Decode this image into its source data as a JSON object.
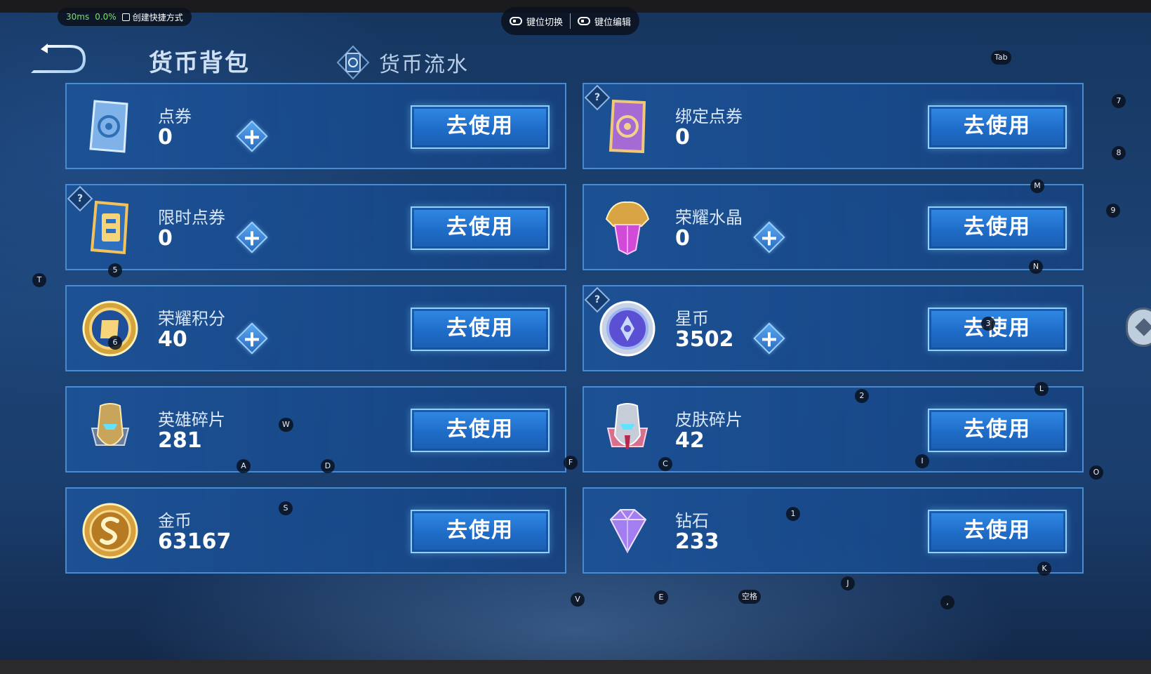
{
  "overlay": {
    "latency": "30ms",
    "loss": "0.0%",
    "shortcut_label": "创建快捷方式",
    "key_switch_label": "键位切换",
    "key_edit_label": "键位编辑"
  },
  "header": {
    "title": "货币背包",
    "flow_tab": "货币流水"
  },
  "use_label": "去使用",
  "help_mark": "?",
  "cards": [
    {
      "name": "点券",
      "value": "0",
      "icon": "coupon-icon",
      "plus": true,
      "help": false
    },
    {
      "name": "绑定点券",
      "value": "0",
      "icon": "bound-coupon-icon",
      "plus": false,
      "help": true
    },
    {
      "name": "限时点券",
      "value": "0",
      "icon": "limited-coupon-icon",
      "plus": true,
      "help": true
    },
    {
      "name": "荣耀水晶",
      "value": "0",
      "icon": "glory-crystal-icon",
      "plus": true,
      "help": false
    },
    {
      "name": "荣耀积分",
      "value": "40",
      "icon": "glory-points-icon",
      "plus": true,
      "help": false
    },
    {
      "name": "星币",
      "value": "3502",
      "icon": "star-coin-icon",
      "plus": true,
      "help": true
    },
    {
      "name": "英雄碎片",
      "value": "281",
      "icon": "hero-fragment-icon",
      "plus": false,
      "help": false
    },
    {
      "name": "皮肤碎片",
      "value": "42",
      "icon": "skin-fragment-icon",
      "plus": false,
      "help": false
    },
    {
      "name": "金币",
      "value": "63167",
      "icon": "gold-coin-icon",
      "plus": false,
      "help": false
    },
    {
      "name": "钻石",
      "value": "233",
      "icon": "diamond-icon",
      "plus": false,
      "help": false
    }
  ],
  "keys": {
    "tab": "Tab",
    "k7": "7",
    "k8": "8",
    "k9": "9",
    "m": "M",
    "n": "N",
    "t": "T",
    "k5": "5",
    "k6": "6",
    "k3": "3",
    "k2": "2",
    "l": "L",
    "w": "W",
    "a": "A",
    "d": "D",
    "f": "F",
    "c": "C",
    "i": "I",
    "o": "O",
    "s": "S",
    "k1": "1",
    "k": "K",
    "j": "J",
    "v": "V",
    "e": "E",
    "space": "空格",
    "comma": ","
  }
}
